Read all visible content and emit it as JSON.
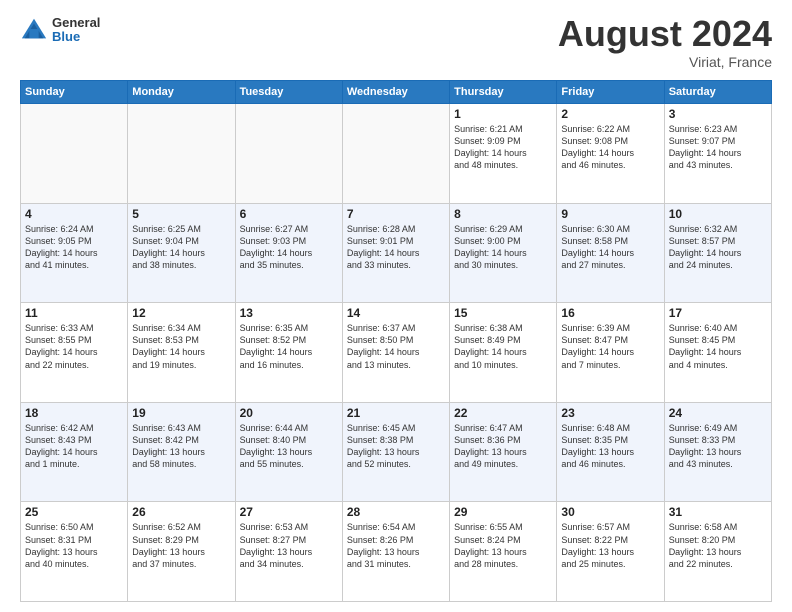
{
  "header": {
    "logo": {
      "general": "General",
      "blue": "Blue"
    },
    "title": "August 2024",
    "location": "Viriat, France"
  },
  "calendar": {
    "days_of_week": [
      "Sunday",
      "Monday",
      "Tuesday",
      "Wednesday",
      "Thursday",
      "Friday",
      "Saturday"
    ],
    "weeks": [
      [
        {
          "day": "",
          "info": ""
        },
        {
          "day": "",
          "info": ""
        },
        {
          "day": "",
          "info": ""
        },
        {
          "day": "",
          "info": ""
        },
        {
          "day": "1",
          "info": "Sunrise: 6:21 AM\nSunset: 9:09 PM\nDaylight: 14 hours\nand 48 minutes."
        },
        {
          "day": "2",
          "info": "Sunrise: 6:22 AM\nSunset: 9:08 PM\nDaylight: 14 hours\nand 46 minutes."
        },
        {
          "day": "3",
          "info": "Sunrise: 6:23 AM\nSunset: 9:07 PM\nDaylight: 14 hours\nand 43 minutes."
        }
      ],
      [
        {
          "day": "4",
          "info": "Sunrise: 6:24 AM\nSunset: 9:05 PM\nDaylight: 14 hours\nand 41 minutes."
        },
        {
          "day": "5",
          "info": "Sunrise: 6:25 AM\nSunset: 9:04 PM\nDaylight: 14 hours\nand 38 minutes."
        },
        {
          "day": "6",
          "info": "Sunrise: 6:27 AM\nSunset: 9:03 PM\nDaylight: 14 hours\nand 35 minutes."
        },
        {
          "day": "7",
          "info": "Sunrise: 6:28 AM\nSunset: 9:01 PM\nDaylight: 14 hours\nand 33 minutes."
        },
        {
          "day": "8",
          "info": "Sunrise: 6:29 AM\nSunset: 9:00 PM\nDaylight: 14 hours\nand 30 minutes."
        },
        {
          "day": "9",
          "info": "Sunrise: 6:30 AM\nSunset: 8:58 PM\nDaylight: 14 hours\nand 27 minutes."
        },
        {
          "day": "10",
          "info": "Sunrise: 6:32 AM\nSunset: 8:57 PM\nDaylight: 14 hours\nand 24 minutes."
        }
      ],
      [
        {
          "day": "11",
          "info": "Sunrise: 6:33 AM\nSunset: 8:55 PM\nDaylight: 14 hours\nand 22 minutes."
        },
        {
          "day": "12",
          "info": "Sunrise: 6:34 AM\nSunset: 8:53 PM\nDaylight: 14 hours\nand 19 minutes."
        },
        {
          "day": "13",
          "info": "Sunrise: 6:35 AM\nSunset: 8:52 PM\nDaylight: 14 hours\nand 16 minutes."
        },
        {
          "day": "14",
          "info": "Sunrise: 6:37 AM\nSunset: 8:50 PM\nDaylight: 14 hours\nand 13 minutes."
        },
        {
          "day": "15",
          "info": "Sunrise: 6:38 AM\nSunset: 8:49 PM\nDaylight: 14 hours\nand 10 minutes."
        },
        {
          "day": "16",
          "info": "Sunrise: 6:39 AM\nSunset: 8:47 PM\nDaylight: 14 hours\nand 7 minutes."
        },
        {
          "day": "17",
          "info": "Sunrise: 6:40 AM\nSunset: 8:45 PM\nDaylight: 14 hours\nand 4 minutes."
        }
      ],
      [
        {
          "day": "18",
          "info": "Sunrise: 6:42 AM\nSunset: 8:43 PM\nDaylight: 14 hours\nand 1 minute."
        },
        {
          "day": "19",
          "info": "Sunrise: 6:43 AM\nSunset: 8:42 PM\nDaylight: 13 hours\nand 58 minutes."
        },
        {
          "day": "20",
          "info": "Sunrise: 6:44 AM\nSunset: 8:40 PM\nDaylight: 13 hours\nand 55 minutes."
        },
        {
          "day": "21",
          "info": "Sunrise: 6:45 AM\nSunset: 8:38 PM\nDaylight: 13 hours\nand 52 minutes."
        },
        {
          "day": "22",
          "info": "Sunrise: 6:47 AM\nSunset: 8:36 PM\nDaylight: 13 hours\nand 49 minutes."
        },
        {
          "day": "23",
          "info": "Sunrise: 6:48 AM\nSunset: 8:35 PM\nDaylight: 13 hours\nand 46 minutes."
        },
        {
          "day": "24",
          "info": "Sunrise: 6:49 AM\nSunset: 8:33 PM\nDaylight: 13 hours\nand 43 minutes."
        }
      ],
      [
        {
          "day": "25",
          "info": "Sunrise: 6:50 AM\nSunset: 8:31 PM\nDaylight: 13 hours\nand 40 minutes."
        },
        {
          "day": "26",
          "info": "Sunrise: 6:52 AM\nSunset: 8:29 PM\nDaylight: 13 hours\nand 37 minutes."
        },
        {
          "day": "27",
          "info": "Sunrise: 6:53 AM\nSunset: 8:27 PM\nDaylight: 13 hours\nand 34 minutes."
        },
        {
          "day": "28",
          "info": "Sunrise: 6:54 AM\nSunset: 8:26 PM\nDaylight: 13 hours\nand 31 minutes."
        },
        {
          "day": "29",
          "info": "Sunrise: 6:55 AM\nSunset: 8:24 PM\nDaylight: 13 hours\nand 28 minutes."
        },
        {
          "day": "30",
          "info": "Sunrise: 6:57 AM\nSunset: 8:22 PM\nDaylight: 13 hours\nand 25 minutes."
        },
        {
          "day": "31",
          "info": "Sunrise: 6:58 AM\nSunset: 8:20 PM\nDaylight: 13 hours\nand 22 minutes."
        }
      ]
    ]
  }
}
